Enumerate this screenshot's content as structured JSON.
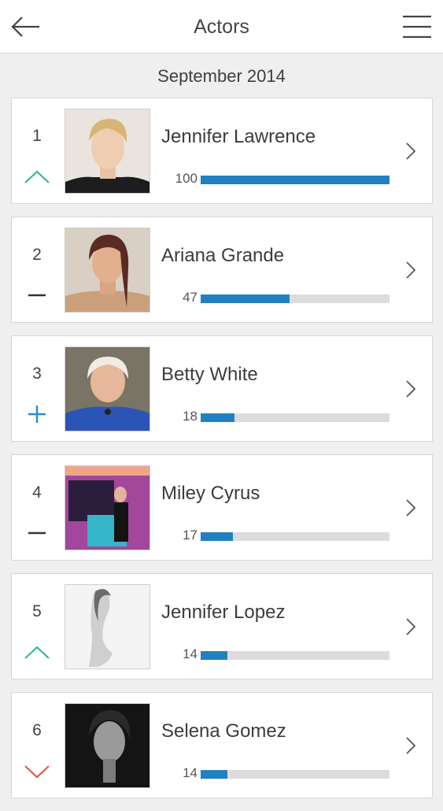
{
  "header": {
    "title": "Actors",
    "back_icon": "back-arrow-icon",
    "menu_icon": "hamburger-menu-icon"
  },
  "period": "September 2014",
  "colors": {
    "bar": "#2180c1",
    "track": "#dcdcdc",
    "up": "#2fb68f",
    "down": "#e2533e",
    "new": "#1f8fd0",
    "same": "#333333"
  },
  "actors": [
    {
      "rank": "1",
      "name": "Jennifer Lawrence",
      "score": "100",
      "progress": 100,
      "trend": "up"
    },
    {
      "rank": "2",
      "name": "Ariana Grande",
      "score": "47",
      "progress": 47,
      "trend": "same"
    },
    {
      "rank": "3",
      "name": "Betty White",
      "score": "18",
      "progress": 18,
      "trend": "new"
    },
    {
      "rank": "4",
      "name": "Miley Cyrus",
      "score": "17",
      "progress": 17,
      "trend": "same"
    },
    {
      "rank": "5",
      "name": "Jennifer Lopez",
      "score": "14",
      "progress": 14,
      "trend": "up"
    },
    {
      "rank": "6",
      "name": "Selena Gomez",
      "score": "14",
      "progress": 14,
      "trend": "down"
    }
  ]
}
